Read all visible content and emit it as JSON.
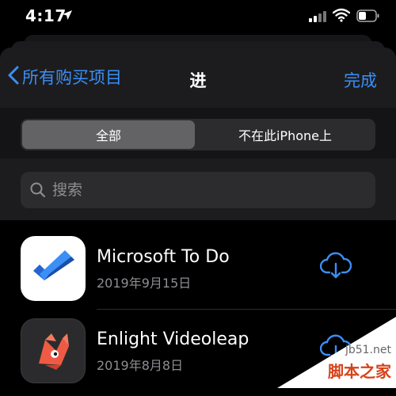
{
  "status_bar": {
    "time": "4:17"
  },
  "nav": {
    "back_label": "所有购买项目",
    "title": "进",
    "done_label": "完成"
  },
  "segments": {
    "all_label": "全部",
    "not_on_device_label": "不在此iPhone上",
    "selected": "全部"
  },
  "search": {
    "placeholder": "搜索"
  },
  "apps": [
    {
      "name": "Microsoft To Do",
      "date": "2019年9月15日",
      "icon": "microsoft-todo-icon",
      "action": "download-cloud-icon"
    },
    {
      "name": "Enlight Videoleap",
      "date": "2019年8月8日",
      "icon": "videoleap-icon",
      "action": "download-cloud-icon"
    }
  ],
  "watermark": {
    "url": "jb51.net",
    "logo": "脚本之家"
  },
  "colors": {
    "accent": "#3b8ff6",
    "background": "#000000",
    "sheet": "#1c1c1e"
  }
}
